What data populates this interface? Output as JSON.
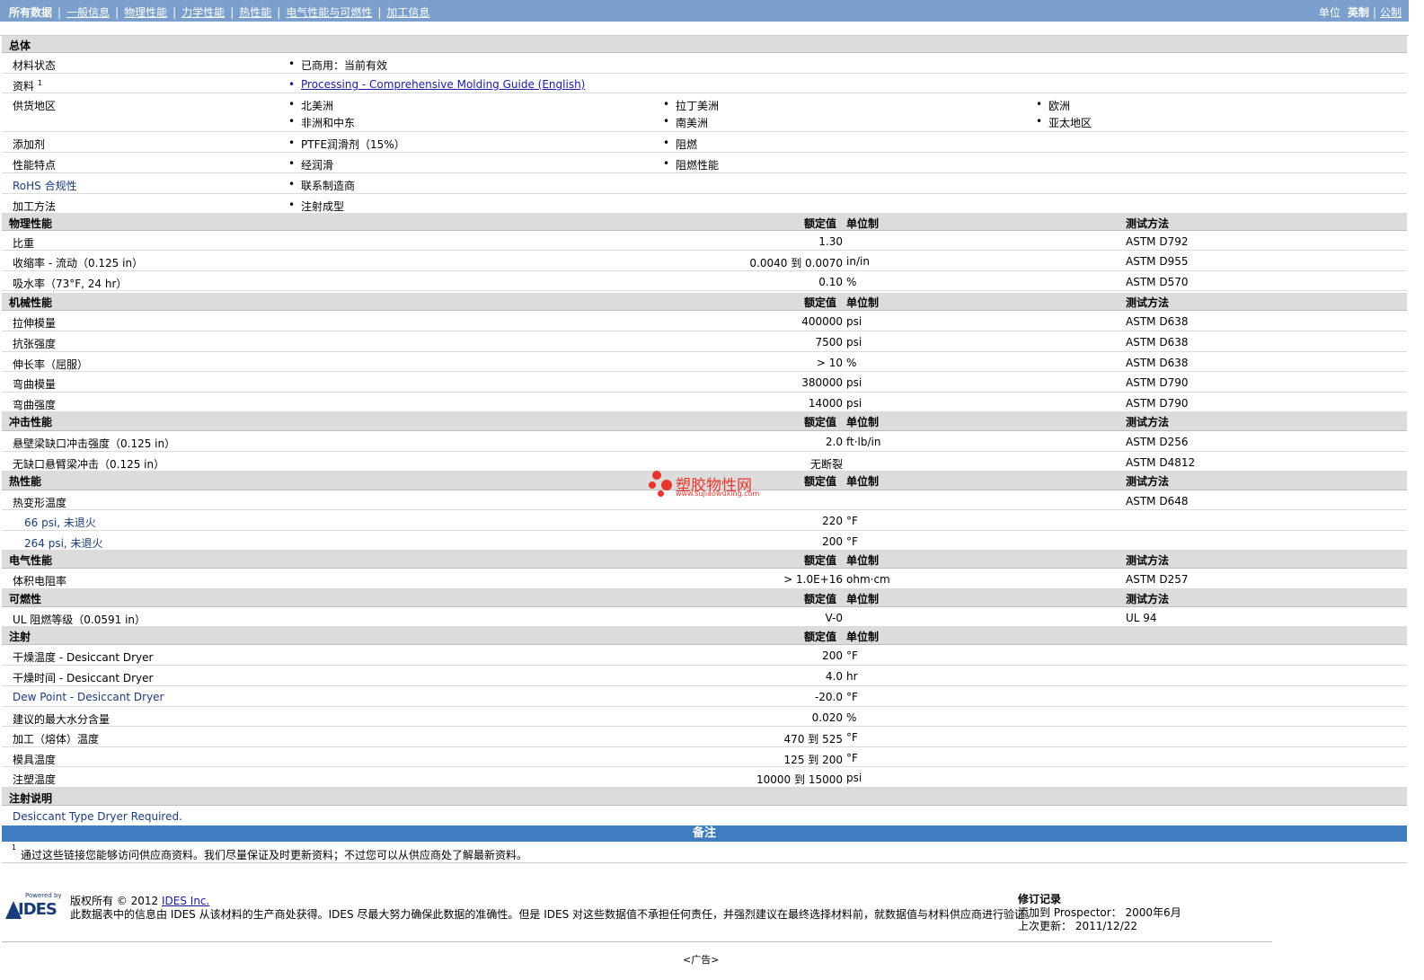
{
  "nav": {
    "items": [
      "所有数据",
      "一般信息",
      "物理性能",
      "力学性能",
      "热性能",
      "电气性能与可燃性",
      "加工信息"
    ],
    "units_label": "单位",
    "units_en": "英制",
    "units_metric": "公制"
  },
  "general": {
    "title": "总体",
    "status_label": "材料状态",
    "status_value": "已商用：当前有效",
    "docs_label": "资料",
    "docs_sup": "1",
    "docs_link": "Processing - Comprehensive Molding Guide (English)",
    "regions_label": "供货地区",
    "regions": [
      "北美洲",
      "拉丁美洲",
      "欧洲",
      "非洲和中东",
      "南美洲",
      "亚太地区"
    ],
    "additives_label": "添加剂",
    "additives": [
      "PTFE润滑剂（15%）",
      "阻燃"
    ],
    "features_label": "性能特点",
    "features": [
      "经润滑",
      "阻燃性能"
    ],
    "rohs_label": "RoHS 合规性",
    "rohs_value": "联系制造商",
    "process_label": "加工方法",
    "process_value": "注射成型"
  },
  "headers": {
    "rated": "额定值",
    "unit": "单位制",
    "method": "测试方法"
  },
  "sections": {
    "physical": {
      "title": "物理性能",
      "rows": [
        {
          "label": "比重",
          "value": "1.30",
          "unit": "",
          "method": "ASTM D792"
        },
        {
          "label": "收缩率 - 流动（0.125 in）",
          "value": "0.0040 到  0.0070",
          "unit": "in/in",
          "method": "ASTM D955"
        },
        {
          "label": "吸水率（73°F, 24 hr）",
          "value": "0.10",
          "unit": "%",
          "method": "ASTM D570"
        }
      ]
    },
    "mechanical": {
      "title": "机械性能",
      "rows": [
        {
          "label": "拉伸模量",
          "value": "400000",
          "unit": "psi",
          "method": "ASTM D638"
        },
        {
          "label": "抗张强度",
          "value": "7500",
          "unit": "psi",
          "method": "ASTM D638"
        },
        {
          "label": "伸长率（屈服）",
          "value": "> 10",
          "unit": "%",
          "method": "ASTM D638"
        },
        {
          "label": "弯曲模量",
          "value": "380000",
          "unit": "psi",
          "method": "ASTM D790"
        },
        {
          "label": "弯曲强度",
          "value": "14000",
          "unit": "psi",
          "method": "ASTM D790"
        }
      ]
    },
    "impact": {
      "title": "冲击性能",
      "rows": [
        {
          "label": "悬壁梁缺口冲击强度（0.125 in）",
          "value": "2.0",
          "unit": "ft·lb/in",
          "method": "ASTM D256"
        },
        {
          "label": "无缺口悬臂梁冲击（0.125 in）",
          "value": "无断裂",
          "unit": "",
          "method": "ASTM D4812"
        }
      ]
    },
    "thermal": {
      "title": "热性能",
      "rows": [
        {
          "label": "热变形温度",
          "value": "",
          "unit": "",
          "method": "ASTM D648"
        },
        {
          "label": "66 psi, 未退火",
          "value": "220",
          "unit": "°F",
          "method": ""
        },
        {
          "label": "264 psi, 未退火",
          "value": "200",
          "unit": "°F",
          "method": ""
        }
      ]
    },
    "electrical": {
      "title": "电气性能",
      "rows": [
        {
          "label": "体积电阻率",
          "value": "> 1.0E+16",
          "unit": "ohm·cm",
          "method": "ASTM D257"
        }
      ]
    },
    "flammability": {
      "title": "可燃性",
      "rows": [
        {
          "label": "UL 阻燃等级（0.0591 in）",
          "value": "V-0",
          "unit": "",
          "method": "UL 94"
        }
      ]
    },
    "injection": {
      "title": "注射",
      "rows": [
        {
          "label": "干燥温度 - Desiccant Dryer",
          "value": "200",
          "unit": "°F",
          "method": ""
        },
        {
          "label": "干燥时间 - Desiccant Dryer",
          "value": "4.0",
          "unit": "hr",
          "method": ""
        },
        {
          "label": "Dew Point - Desiccant Dryer",
          "value": "-20.0",
          "unit": "°F",
          "method": ""
        },
        {
          "label": "建议的最大水分含量",
          "value": "0.020",
          "unit": "%",
          "method": ""
        },
        {
          "label": "加工（熔体）温度",
          "value": "470 到  525",
          "unit": "°F",
          "method": ""
        },
        {
          "label": "模具温度",
          "value": "125 到  200",
          "unit": "°F",
          "method": ""
        },
        {
          "label": "注塑温度",
          "value": "10000 到  15000",
          "unit": "psi",
          "method": ""
        }
      ]
    }
  },
  "injection_notes": {
    "title": "注射说明",
    "text": "Desiccant Type Dryer Required."
  },
  "notes": {
    "title": "备注",
    "sup": "1",
    "text": "通过这些链接您能够访问供应商资料。我们尽量保证及时更新资料；不过您可以从供应商处了解最新资料。"
  },
  "footer": {
    "powered_by": "Powered by",
    "logo_text": "IDES",
    "copyright_prefix": "版权所有 © 2012 ",
    "copyright_link": "IDES Inc.",
    "disclaimer": "此数据表中的信息由 IDES 从该材料的生产商处获得。IDES 尽最大努力确保此数据的准确性。但是 IDES 对这些数据值不承担任何责任，并强烈建议在最终选择材料前，就数据值与材料供应商进行验证。",
    "revision_title": "修订记录",
    "added_label": "添加到 Prospector：",
    "added_value": "2000年6月",
    "updated_label": "上次更新：",
    "updated_value": "2011/12/22",
    "ad": "<广告>"
  },
  "watermark": {
    "title": "塑胶物性网",
    "url": "www.sujiaowuxing.com",
    "color": "#e8362d"
  }
}
